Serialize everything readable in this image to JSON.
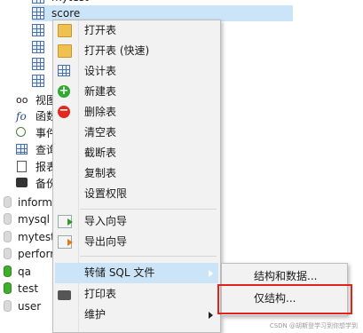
{
  "tree": {
    "items": [
      {
        "label": "mytest",
        "icon": "table-icon"
      },
      {
        "label": "score",
        "icon": "table-icon"
      },
      {
        "label": "视图",
        "icon": "view-icon"
      },
      {
        "label": "函数",
        "icon": "function-icon"
      },
      {
        "label": "事件",
        "icon": "event-icon"
      },
      {
        "label": "查询",
        "icon": "query-icon"
      },
      {
        "label": "报表",
        "icon": "report-icon"
      },
      {
        "label": "备份",
        "icon": "backup-icon"
      },
      {
        "label": "information_schema",
        "icon": "database-icon"
      },
      {
        "label": "mysql",
        "icon": "database-icon"
      },
      {
        "label": "mytest",
        "icon": "database-icon"
      },
      {
        "label": "performance_schema",
        "icon": "database-icon"
      },
      {
        "label": "qa",
        "icon": "database-icon"
      },
      {
        "label": "test",
        "icon": "database-icon"
      },
      {
        "label": "user",
        "icon": "database-icon"
      }
    ]
  },
  "context_menu": {
    "items": [
      {
        "label": "打开表",
        "icon": "folder-open-icon"
      },
      {
        "label": "打开表 (快速)",
        "icon": "folder-open-fast-icon"
      },
      {
        "label": "设计表",
        "icon": "design-table-icon"
      },
      {
        "label": "新建表",
        "icon": "add-table-icon"
      },
      {
        "label": "删除表",
        "icon": "delete-table-icon"
      },
      {
        "label": "清空表",
        "icon": ""
      },
      {
        "label": "截断表",
        "icon": ""
      },
      {
        "label": "复制表",
        "icon": ""
      },
      {
        "label": "设置权限",
        "icon": ""
      },
      {
        "label": "导入向导",
        "icon": "import-wizard-icon"
      },
      {
        "label": "导出向导",
        "icon": "export-wizard-icon"
      },
      {
        "label": "转储 SQL 文件",
        "icon": ""
      },
      {
        "label": "打印表",
        "icon": "print-icon"
      },
      {
        "label": "维护",
        "icon": ""
      }
    ]
  },
  "submenu": {
    "items": [
      {
        "label": "结构和数据..."
      },
      {
        "label": "仅结构..."
      }
    ]
  },
  "watermark": "CSDN @胡斯登学习到你想学到",
  "colors": {
    "highlight": "#cce4f7",
    "menu_bg": "#f2f2f2",
    "annotation_red": "#e0241b"
  }
}
